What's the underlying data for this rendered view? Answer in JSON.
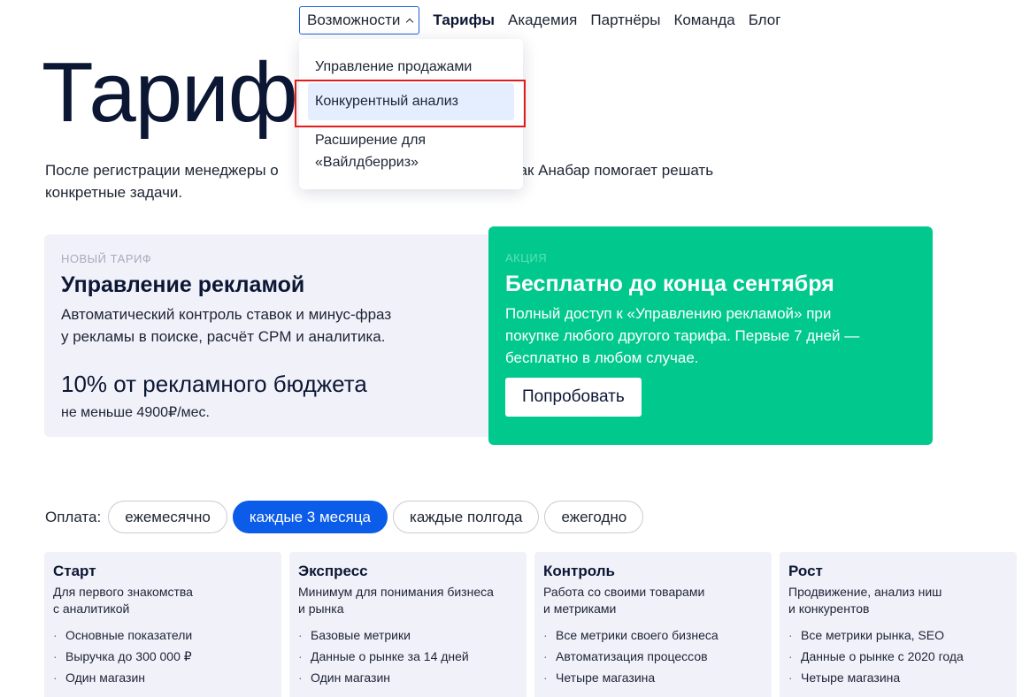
{
  "nav": {
    "features_label": "Возможности",
    "links": [
      "Тарифы",
      "Академия",
      "Партнёры",
      "Команда",
      "Блог"
    ]
  },
  "dropdown": {
    "items": [
      "Управление продажами",
      "Конкурентный анализ",
      "Расширение для «Вайлдберриз»"
    ]
  },
  "hero": {
    "title": "Тарифы",
    "subtitle": "После регистрации менеджеры о",
    "subtitle_tail": "как Анабар помогает решать",
    "subtitle_line2": "конкретные задачи."
  },
  "ads_card": {
    "eyebrow": "Новый тариф",
    "title": "Управление рекламой",
    "desc_line1": "Автоматический контроль ставок и минус-фраз",
    "desc_line2": "у рекламы в поиске, расчёт CPM и аналитика.",
    "price": "10% от рекламного бюджета",
    "price_note": "не меньше 4900₽/мес."
  },
  "promo_card": {
    "eyebrow": "Акция",
    "title": "Бесплатно до конца сентября",
    "desc_line1": "Полный доступ к «Управлению рекламой» при",
    "desc_line2": "покупке любого другого тарифа. Первые 7 дней —",
    "desc_line3": "бесплатно в любом случае.",
    "button": "Попробовать"
  },
  "payment": {
    "label": "Оплата:",
    "options": [
      "ежемесячно",
      "каждые 3 месяца",
      "каждые полгода",
      "ежегодно"
    ],
    "selected": "каждые 3 месяца"
  },
  "plans": [
    {
      "name": "Старт",
      "desc1": "Для первого знакомства",
      "desc2": "с аналитикой",
      "features": [
        "Основные показатели",
        "Выручка до 300 000 ₽",
        "Один магазин"
      ]
    },
    {
      "name": "Экспресс",
      "desc1": "Минимум для понимания бизнеса",
      "desc2": "и рынка",
      "features": [
        "Базовые метрики",
        "Данные о рынке за 14 дней",
        "Один магазин"
      ]
    },
    {
      "name": "Контроль",
      "desc1": "Работа со своими товарами",
      "desc2": "и метриками",
      "features": [
        "Все метрики своего бизнеса",
        "Автоматизация процессов",
        "Четыре магазина"
      ]
    },
    {
      "name": "Рост",
      "desc1": "Продвижение, анализ ниш",
      "desc2": "и конкурентов",
      "features": [
        "Все метрики рынка, SEO",
        "Данные о рынке с 2020 года",
        "Четыре магазина"
      ]
    }
  ],
  "colors": {
    "accent_blue": "#0a5ce9",
    "promo_green": "#01c98d",
    "highlight_red": "#e31b1b"
  }
}
